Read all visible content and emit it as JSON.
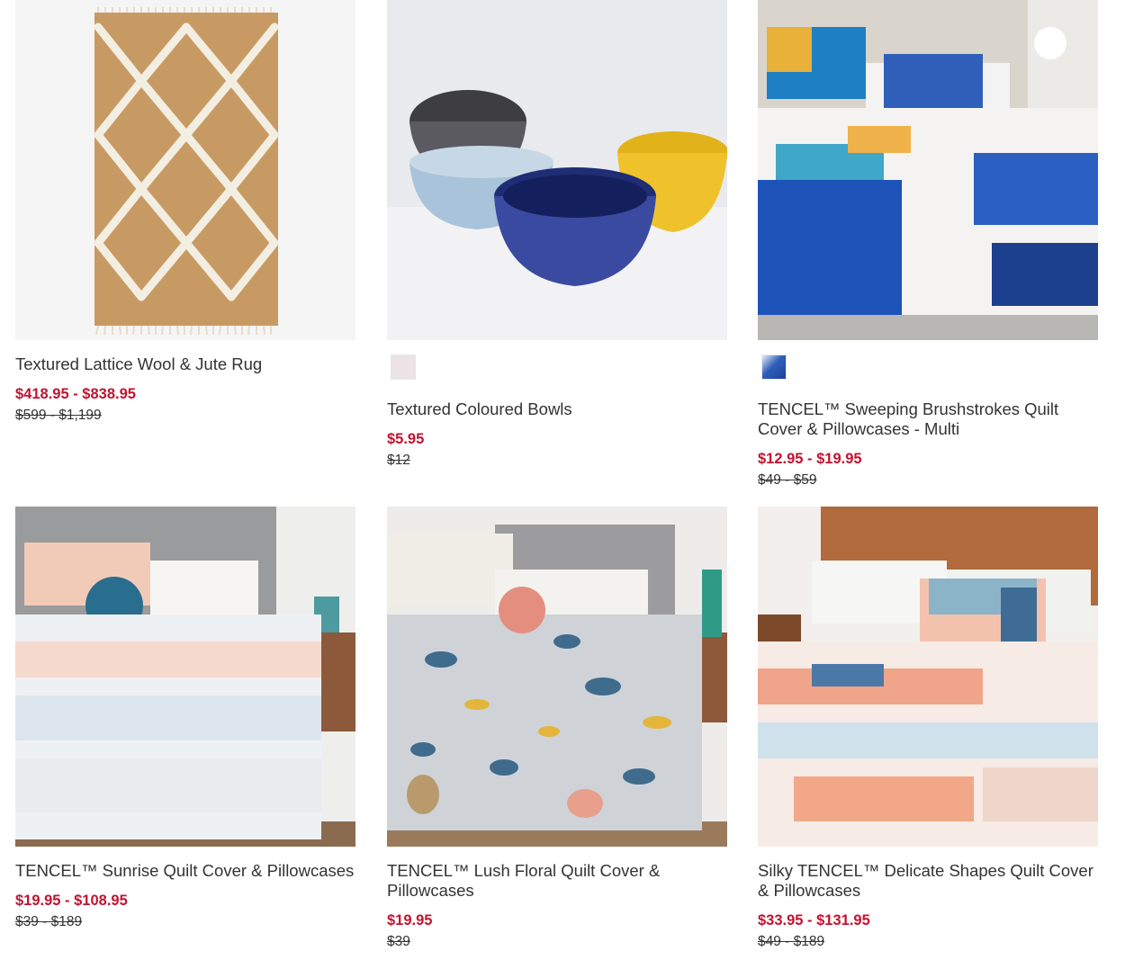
{
  "colors": {
    "sale": "#c41230",
    "text": "#333333"
  },
  "products": [
    {
      "title": "Textured Lattice Wool & Jute Rug",
      "sale_price": "$418.95 - $838.95",
      "original_price": "$599 - $1,199",
      "swatches": []
    },
    {
      "title": "Textured Coloured Bowls",
      "sale_price": "$5.95",
      "original_price": "$12",
      "swatches": [
        "#ebe3e6"
      ]
    },
    {
      "title": "TENCEL™ Sweeping Brushstrokes Quilt Cover & Pillowcases - Multi",
      "sale_price": "$12.95 - $19.95",
      "original_price": "$49 - $59",
      "swatches": [
        "#2f5fb8"
      ]
    },
    {
      "title": "TENCEL™ Sunrise Quilt Cover & Pillowcases",
      "sale_price": "$19.95 - $108.95",
      "original_price": "$39 - $189",
      "swatches": []
    },
    {
      "title": "TENCEL™ Lush Floral Quilt Cover & Pillowcases",
      "sale_price": "$19.95",
      "original_price": "$39",
      "swatches": []
    },
    {
      "title": "Silky TENCEL™ Delicate Shapes Quilt Cover & Pillowcases",
      "sale_price": "$33.95 - $131.95",
      "original_price": "$49 - $189",
      "swatches": []
    }
  ]
}
